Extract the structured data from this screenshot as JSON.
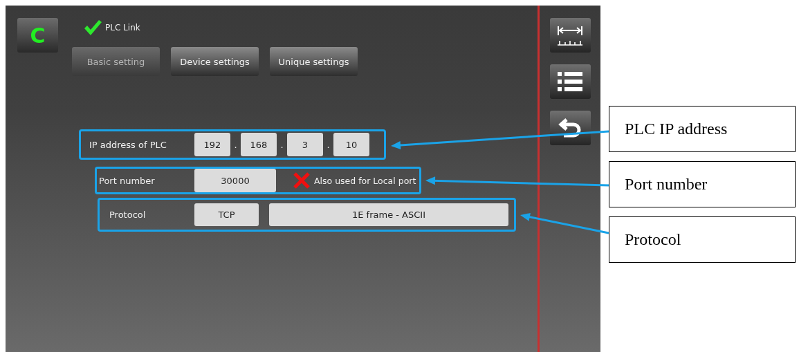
{
  "header": {
    "mode_button": "C",
    "status": {
      "label": "PLC Link",
      "ok": true
    }
  },
  "tabs": [
    {
      "label": "Basic setting",
      "disabled": true
    },
    {
      "label": "Device settings",
      "disabled": false
    },
    {
      "label": "Unique settings",
      "disabled": false
    }
  ],
  "ip_row": {
    "label": "IP address of PLC",
    "octets": [
      "192",
      "168",
      "3",
      "10"
    ],
    "separators": [
      ".",
      ".",
      "."
    ]
  },
  "port_row": {
    "label": "Port number",
    "value": "30000",
    "note": {
      "text": "Also used for Local port",
      "checked": false
    }
  },
  "protocol_row": {
    "label": "Protocol",
    "transport": "TCP",
    "frame": "1E frame - ASCII"
  },
  "callouts": [
    {
      "label": "PLC IP address"
    },
    {
      "label": "Port number"
    },
    {
      "label": "Protocol"
    }
  ]
}
